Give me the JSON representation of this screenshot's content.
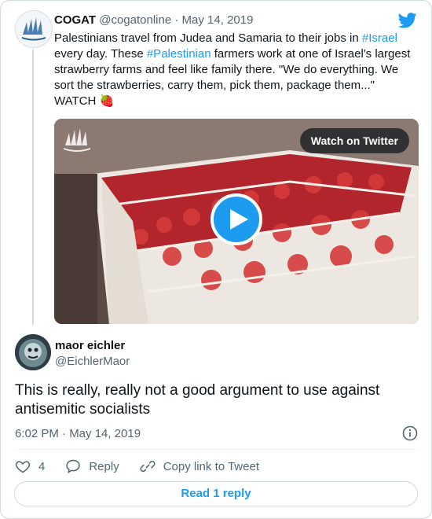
{
  "quoted": {
    "name": "COGAT",
    "handle": "@cogatonline",
    "dot": " · ",
    "date": "May 14, 2019",
    "text_parts": {
      "p1": "Palestinians travel from Judea and Samaria to their jobs in ",
      "h1": "#Israel",
      "p2": " every day. These ",
      "h2": "#Palestinian",
      "p3": " farmers work at one of Israel's largest strawberry farms and feel like family there. \"We do everything. We sort the strawberries, carry them, pick them, package them...\" WATCH 🍓"
    },
    "media": {
      "watch_label": "Watch on Twitter",
      "play_icon": "play-icon"
    }
  },
  "tweet": {
    "name": "maor eichler",
    "handle": "@EichlerMaor",
    "text": "This is really, really not a good argument to use against antisemitic socialists",
    "timestamp": "6:02 PM · May 14, 2019"
  },
  "actions": {
    "like_count": "4",
    "reply_label": "Reply",
    "copy_label": "Copy link to Tweet"
  },
  "read_reply_label": "Read 1 reply",
  "colors": {
    "accent": "#1d9bf0",
    "secondary_text": "#536471",
    "border": "#cfd9de"
  }
}
